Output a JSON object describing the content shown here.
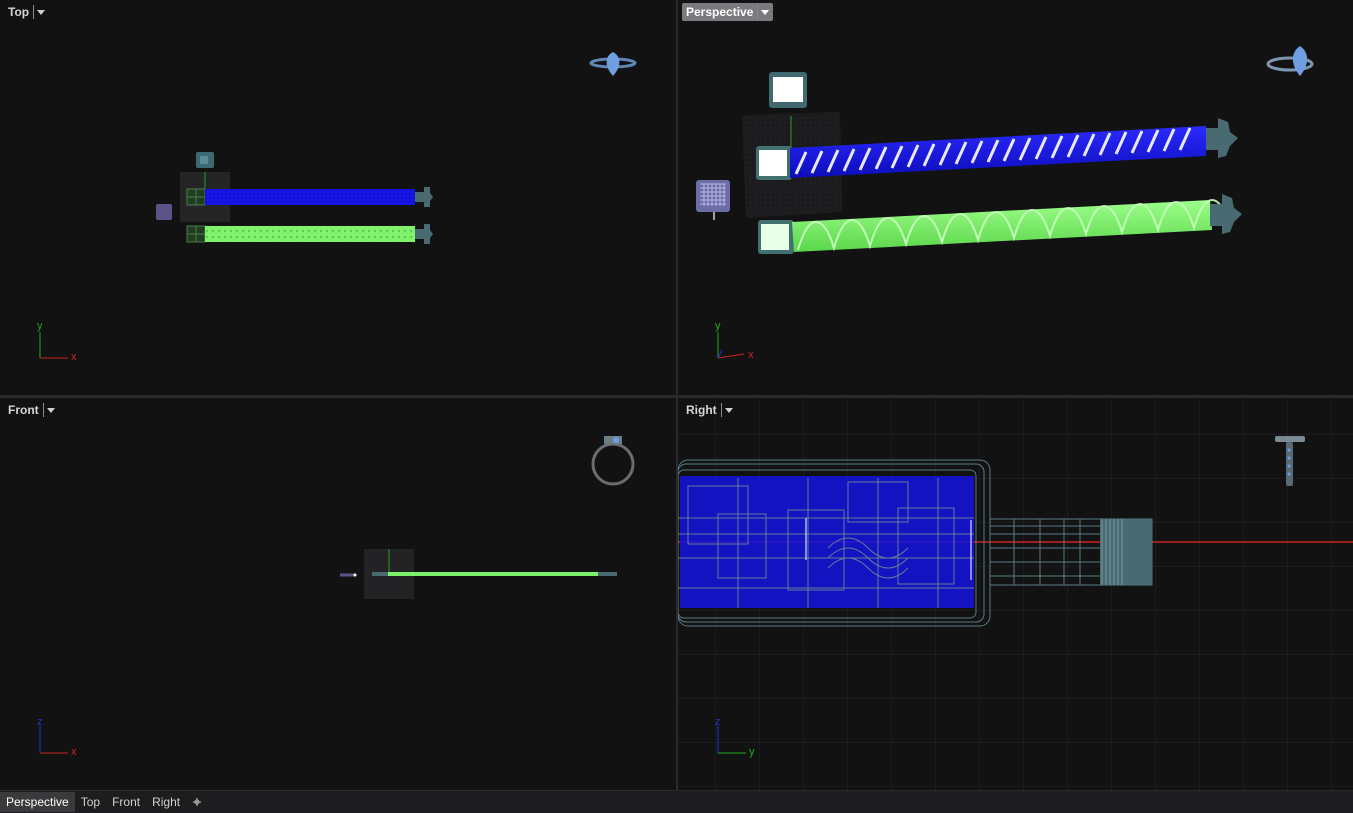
{
  "viewports": {
    "top": {
      "label": "Top",
      "axis_x": "x",
      "axis_y": "y"
    },
    "perspective": {
      "label": "Perspective",
      "axis_x": "x",
      "axis_y": "y"
    },
    "front": {
      "label": "Front",
      "axis_x": "x",
      "axis_y": "z"
    },
    "right": {
      "label": "Right",
      "axis_x": "y",
      "axis_y": "z"
    }
  },
  "tabs": [
    {
      "label": "Perspective",
      "active": true
    },
    {
      "label": "Top",
      "active": false
    },
    {
      "label": "Front",
      "active": false
    },
    {
      "label": "Right",
      "active": false
    }
  ],
  "add_tab_icon": "plus-icon",
  "colors": {
    "background": "#121213",
    "blue_object": "#1a1aff",
    "green_object": "#7cf06a",
    "wire_gray": "#5a7c86",
    "axis_x": "#cc2222",
    "axis_y": "#22aa22",
    "axis_z": "#2233cc",
    "ring_blue": "#6f9fe0"
  }
}
